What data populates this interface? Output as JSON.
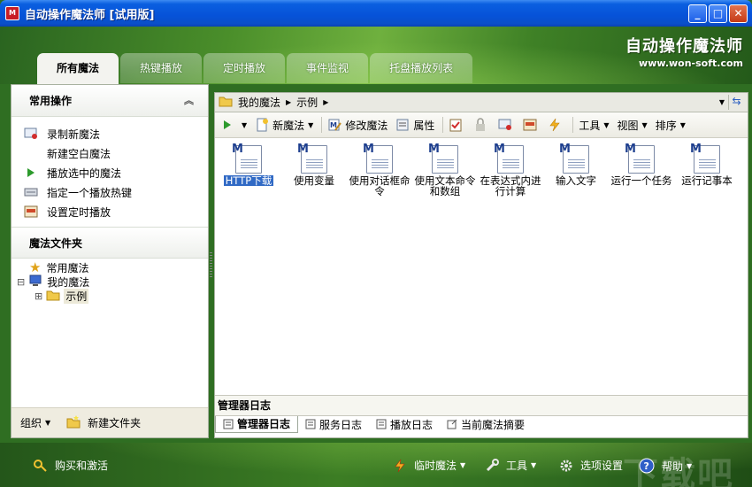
{
  "window": {
    "title": "自动操作魔法师 [试用版]",
    "app_icon_text": "M"
  },
  "brand": {
    "name": "自动操作魔法师",
    "url": "www.won-soft.com"
  },
  "tabs": [
    {
      "label": "所有魔法",
      "active": true
    },
    {
      "label": "热键播放",
      "active": false
    },
    {
      "label": "定时播放",
      "active": false
    },
    {
      "label": "事件监视",
      "active": false
    },
    {
      "label": "托盘播放列表",
      "active": false
    }
  ],
  "sidebar": {
    "common_ops_title": "常用操作",
    "ops": [
      {
        "label": "录制新魔法",
        "icon": "record-icon"
      },
      {
        "label": "新建空白魔法",
        "icon": ""
      },
      {
        "label": "播放选中的魔法",
        "icon": "play-icon"
      },
      {
        "label": "指定一个播放热键",
        "icon": "keyboard-icon"
      },
      {
        "label": "设置定时播放",
        "icon": "timer-icon"
      }
    ],
    "folders_title": "魔法文件夹",
    "tree": [
      {
        "label": "常用魔法",
        "icon": "star-icon"
      },
      {
        "label": "我的魔法",
        "icon": "computer-icon",
        "expander": "⊟"
      },
      {
        "label": "示例",
        "icon": "folder-icon",
        "expander": "⊞"
      }
    ],
    "footer": {
      "organize_label": "组织",
      "new_folder_label": "新建文件夹"
    }
  },
  "address": {
    "root": "我的魔法",
    "current": "示例"
  },
  "toolbar": {
    "new_magic": "新魔法",
    "edit_magic": "修改魔法",
    "properties": "属性",
    "tools": "工具",
    "view": "视图",
    "sort": "排序"
  },
  "files": [
    {
      "label": "HTTP下载",
      "selected": true
    },
    {
      "label": "使用变量",
      "selected": false
    },
    {
      "label": "使用对话框命令",
      "selected": false
    },
    {
      "label": "使用文本命令和数组",
      "selected": false
    },
    {
      "label": "在表达式内进行计算",
      "selected": false
    },
    {
      "label": "输入文字",
      "selected": false
    },
    {
      "label": "运行一个任务",
      "selected": false
    },
    {
      "label": "运行记事本",
      "selected": false
    }
  ],
  "log": {
    "title": "管理器日志",
    "tabs": [
      {
        "label": "管理器日志",
        "active": true
      },
      {
        "label": "服务日志",
        "active": false
      },
      {
        "label": "播放日志",
        "active": false
      },
      {
        "label": "当前魔法摘要",
        "active": false
      }
    ]
  },
  "statusbar": {
    "buy_activate": "购买和激活",
    "temp_magic": "临时魔法",
    "tools": "工具",
    "options": "选项设置",
    "help": "帮助",
    "watermark": "下载吧"
  },
  "colors": {
    "titlebar_blue": "#0652d8",
    "selection_blue": "#316ac5",
    "header_green": "#4a8e2a"
  }
}
